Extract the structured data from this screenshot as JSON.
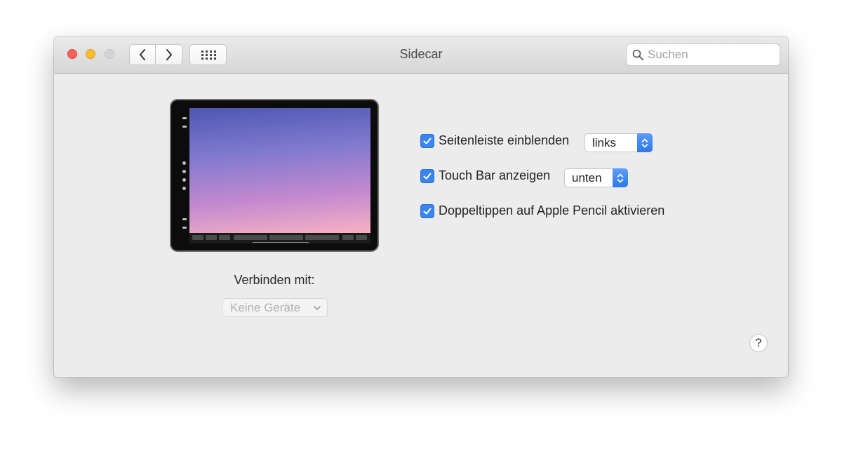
{
  "window": {
    "title": "Sidecar"
  },
  "toolbar": {
    "back_icon": "chevron-left-icon",
    "forward_icon": "chevron-right-icon",
    "grid_icon": "grid-dots-icon",
    "search_placeholder": "Suchen"
  },
  "device": {
    "connect_label": "Verbinden mit:",
    "select_value": "Keine Geräte"
  },
  "options": [
    {
      "label": "Seitenleiste einblenden",
      "checked": true,
      "popup_value": "links"
    },
    {
      "label": "Touch Bar anzeigen",
      "checked": true,
      "popup_value": "unten"
    },
    {
      "label": "Doppeltippen auf Apple Pencil aktivieren",
      "checked": true
    }
  ],
  "help": {
    "label": "?"
  },
  "colors": {
    "accent": "#3a84f5",
    "close": "#fe5f57",
    "minimize": "#febc2e",
    "zoom_disabled": "#d4d4d4"
  }
}
